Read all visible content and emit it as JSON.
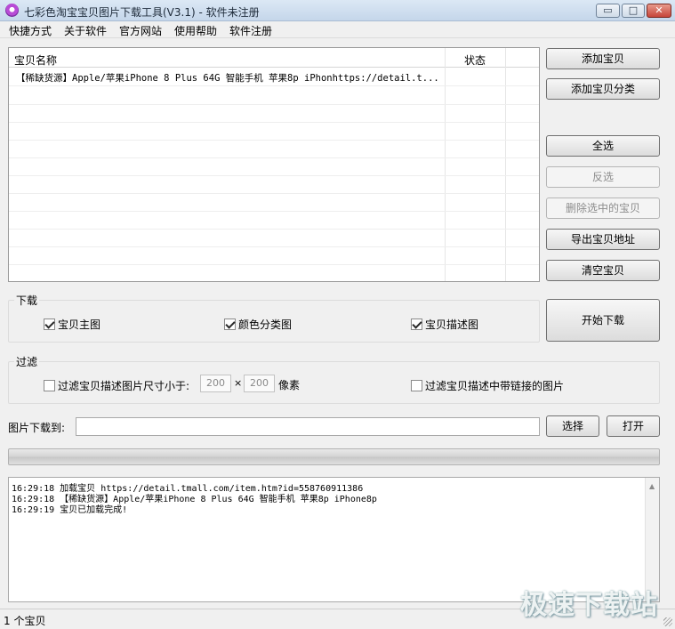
{
  "window": {
    "title": "七彩色淘宝宝贝图片下载工具(V3.1) - 软件未注册",
    "min_glyph": "▭",
    "max_glyph": "□",
    "close_glyph": "✕"
  },
  "menu": [
    "快捷方式",
    "关于软件",
    "官方网站",
    "使用帮助",
    "软件注册"
  ],
  "list": {
    "columns": {
      "name": "宝贝名称",
      "status": "状态"
    },
    "rows": [
      {
        "name": "【稀缺货源】Apple/苹果iPhone 8 Plus 64G 智能手机 苹果8p iPhonhttps://detail.t...",
        "status": ""
      }
    ]
  },
  "side_buttons": {
    "add_item": "添加宝贝",
    "add_category": "添加宝贝分类",
    "select_all": "全选",
    "invert": "反选",
    "delete_selected": "删除选中的宝贝",
    "export": "导出宝贝地址",
    "clear": "清空宝贝"
  },
  "download": {
    "group_label": "下载",
    "main_image": "宝贝主图",
    "color_image": "颜色分类图",
    "desc_image": "宝贝描述图",
    "start_button": "开始下载"
  },
  "filter": {
    "group_label": "过滤",
    "size_filter_label": "过滤宝贝描述图片尺寸小于:",
    "width": "200",
    "times": "×",
    "height": "200",
    "unit": "像素",
    "link_filter_label": "过滤宝贝描述中带链接的图片"
  },
  "path": {
    "label": "图片下载到:",
    "value": "",
    "choose_button": "选择",
    "open_button": "打开"
  },
  "progress": {
    "value": 0
  },
  "log": [
    "16:29:18 加载宝贝 https://detail.tmall.com/item.htm?id=558760911386",
    "16:29:18 【稀缺货源】Apple/苹果iPhone 8 Plus 64G 智能手机 苹果8p iPhone8p",
    "16:29:19 宝贝已加载完成!"
  ],
  "status": {
    "text": "1 个宝贝"
  },
  "watermark": "极速下载站"
}
